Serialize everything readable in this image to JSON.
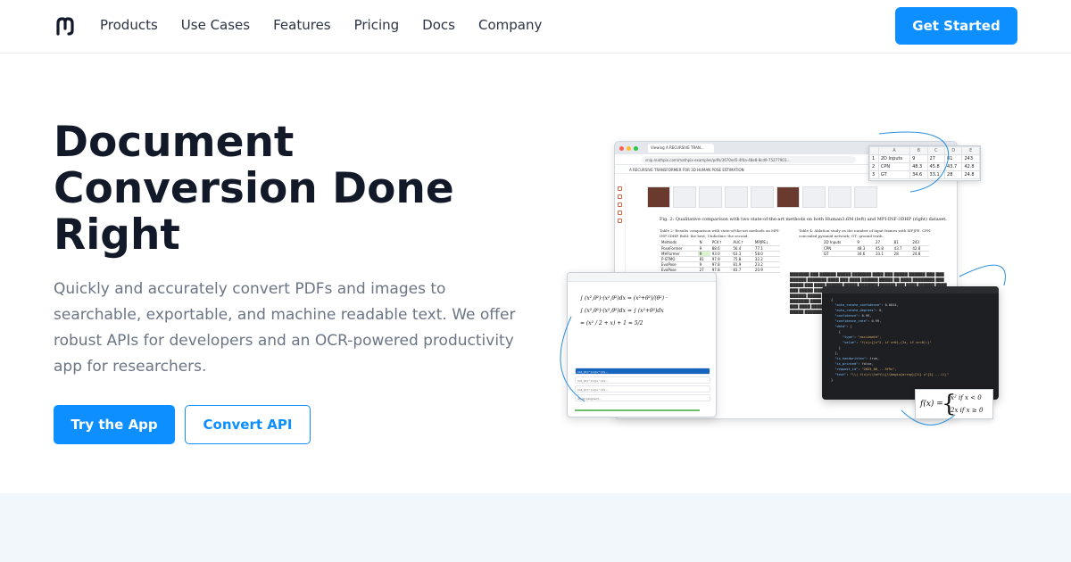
{
  "nav": {
    "links": [
      "Products",
      "Use Cases",
      "Features",
      "Pricing",
      "Docs",
      "Company"
    ],
    "cta": "Get Started"
  },
  "hero": {
    "title": "Document Conversion Done Right",
    "subtitle": "Quickly and accurately convert PDFs and images to searchable, exportable, and machine readable text. We offer robust APIs for developers and an OCR-powered productivity app for researchers.",
    "primary_button": "Try the App",
    "secondary_button": "Convert API"
  },
  "illustration": {
    "browser_tab": "Viewing A RECURSIVE TRAN...",
    "url": "snip.mathpix.com/mathpix-examples/pdfs/3670ed5-4f4a-48e8-8cd9-75277903...",
    "doc_title": "A RECURSIVE TRANSFORMER FOR 3D HUMAN POSE ESTIMATION",
    "fig_caption": "Fig. 2: Qualitative comparison with two state-of-the-art methods on both Human3.6M (left) and MPI-INF-3DHP (right) dataset.",
    "table2_caption": "Table 2: Results comparison with state-of-the-art methods on MPI-INF-3DHP. Bold: the best; Underline: the second.",
    "table4_caption": "Table 4: Ablation study on the number of input frames with MPJPE. CFN: concealed pyramid network; GT: ground truth.",
    "spreadsheet": {
      "header": [
        "",
        "A",
        "B",
        "C",
        "D",
        "E"
      ],
      "rows": [
        [
          "1",
          "2D Inputs",
          "9",
          "27",
          "81",
          "243"
        ],
        [
          "2",
          "CPN",
          "48.3",
          "45.8",
          "43.7",
          "42.8"
        ],
        [
          "3",
          "GT",
          "34.6",
          "33.1",
          "28",
          "24.8"
        ]
      ]
    },
    "formula": {
      "lhs": "f(x) =",
      "case1": "x² if x < 0",
      "case2": "2x if x ≥ 0"
    }
  }
}
